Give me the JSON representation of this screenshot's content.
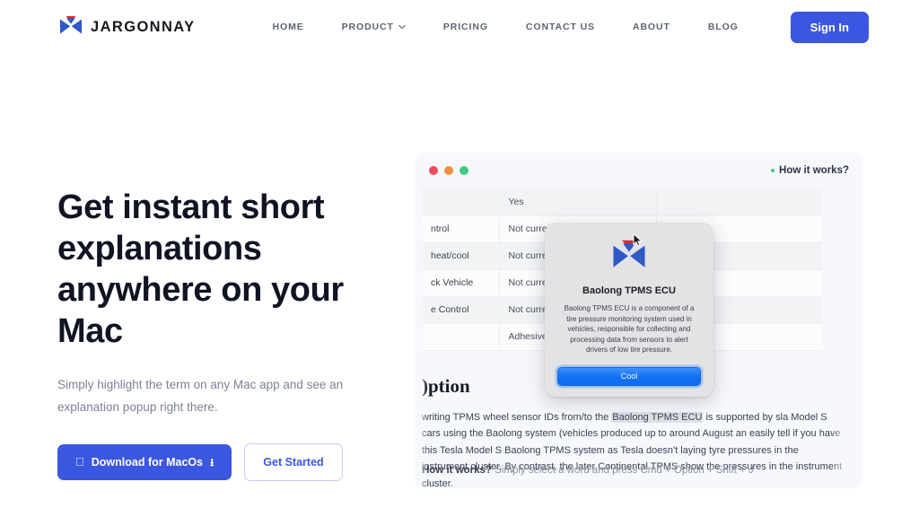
{
  "brand": {
    "name": "JARGONNAY",
    "logo_icon": "bowtie-logo-icon"
  },
  "nav": {
    "items": [
      {
        "label": "HOME",
        "has_caret": false
      },
      {
        "label": "PRODUCT",
        "has_caret": true
      },
      {
        "label": "PRICING",
        "has_caret": false
      },
      {
        "label": "CONTACT US",
        "has_caret": false
      },
      {
        "label": "ABOUT",
        "has_caret": false
      },
      {
        "label": "BLOG",
        "has_caret": false
      }
    ],
    "signin_label": "Sign In"
  },
  "hero": {
    "title": "Get instant short explanations anywhere on your Mac",
    "subtitle": "Simply highlight the term on any Mac app and see an explanation popup right there.",
    "primary_button": {
      "label": "Download for MacOs",
      "leading_icon": "apple-icon",
      "trailing_icon": "download-icon"
    },
    "secondary_button": {
      "label": "Get Started"
    }
  },
  "mockup": {
    "window_controls": [
      "close-red",
      "minimize-orange",
      "maximize-green"
    ],
    "hint_label": "How it works?",
    "table": {
      "rows": [
        {
          "c1": "",
          "c2": "Yes",
          "c3": ""
        },
        {
          "c1": "ntrol",
          "c2": "Not currently s",
          "c3": ""
        },
        {
          "c1": "heat/cool",
          "c2": "Not currently s",
          "c3": ""
        },
        {
          "c1": "ck Vehicle",
          "c2": "Not currently s",
          "c3": ""
        },
        {
          "c1": "e Control",
          "c2": "Not currently s",
          "c3": ""
        },
        {
          "c1": "",
          "c2": "Adhesive velcr",
          "c3": ""
        }
      ]
    },
    "section_heading": ")ption",
    "paragraph": {
      "line1_before": "writing TPMS wheel sensor IDs from/to the ",
      "highlight": "Baolong TPMS ECU",
      "line1_after": " is supported by",
      "rest": "sla Model S cars using the Baolong system (vehicles produced up to around August an easily tell if you have this Tesla Model S Baolong TPMS system as Tesla doesn't laying tyre pressures in the instrument cluster. By contrast, the later Continental TPMS show the pressures in the instrument cluster."
    },
    "footer": {
      "bold": "How it works?",
      "text": " Simply select a word and press Cmd + Option + Shift + J"
    },
    "popup": {
      "logo_icon": "bowtie-logo-icon",
      "title": "Baolong TPMS ECU",
      "body": "Baolong TPMS ECU is a component of a tire pressure monitoring system used in vehicles, responsible for collecting and processing data from sensors to alert drivers of low tire pressure.",
      "button_label": "Cool",
      "cursor_icon": "mouse-pointer-icon"
    }
  },
  "colors": {
    "brand_blue": "#3B56E0",
    "logo_blue": "#2f58c8",
    "logo_red": "#d42d2d",
    "traffic_red": "#EC4B5A",
    "traffic_orange": "#F0913C",
    "traffic_green": "#3DCB7F",
    "heading_dark": "#101423",
    "muted_text": "#7b8393"
  }
}
